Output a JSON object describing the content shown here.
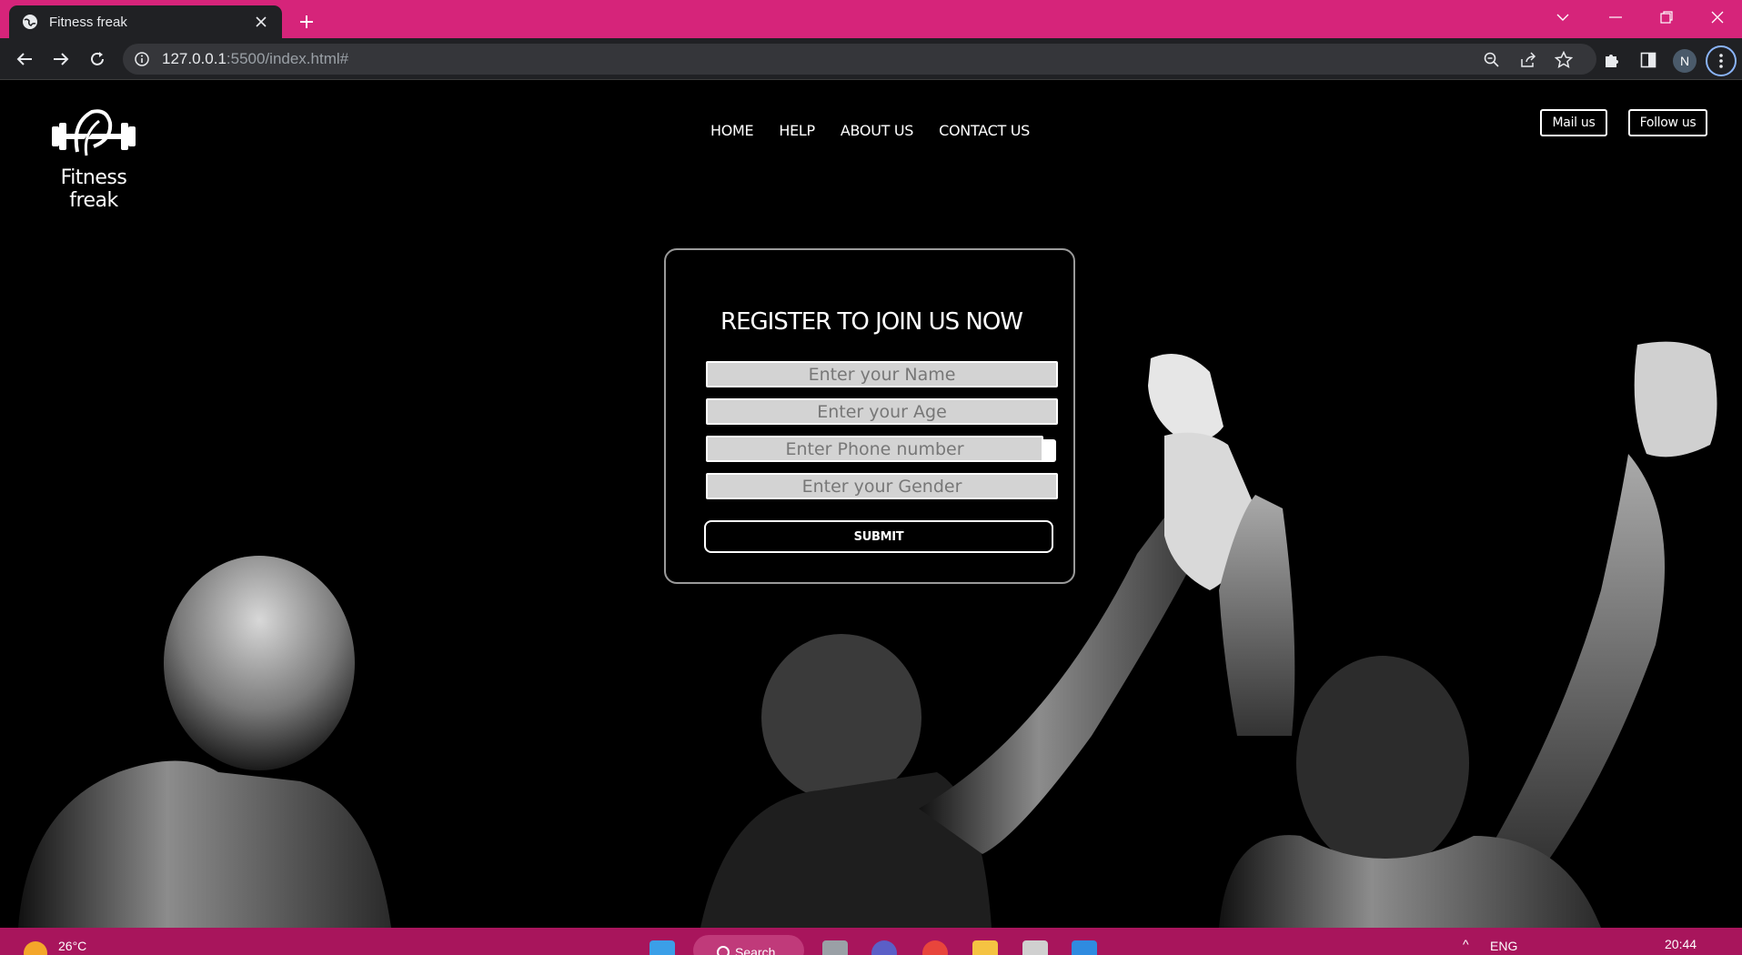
{
  "browser": {
    "tab_title": "Fitness freak",
    "url_host": "127.0.0.1",
    "url_rest": ":5500/index.html#",
    "profile_initial": "N",
    "tabstrip_color": "#d6247a"
  },
  "site": {
    "brand_name": "Fitness freak",
    "nav": [
      "HOME",
      "HELP",
      "ABOUT US",
      "CONTACT US"
    ],
    "mail_button": "Mail us",
    "follow_button": "Follow us"
  },
  "register": {
    "title": "REGISTER TO JOIN US NOW",
    "name_placeholder": "Enter your Name",
    "age_placeholder": "Enter your Age",
    "phone_placeholder": "Enter Phone number",
    "gender_placeholder": "Enter your Gender",
    "submit_label": "SUBMIT"
  },
  "taskbar": {
    "temperature": "26°C",
    "search_label": "Search",
    "language": "ENG",
    "time": "20:44",
    "color": "#a8155c"
  }
}
